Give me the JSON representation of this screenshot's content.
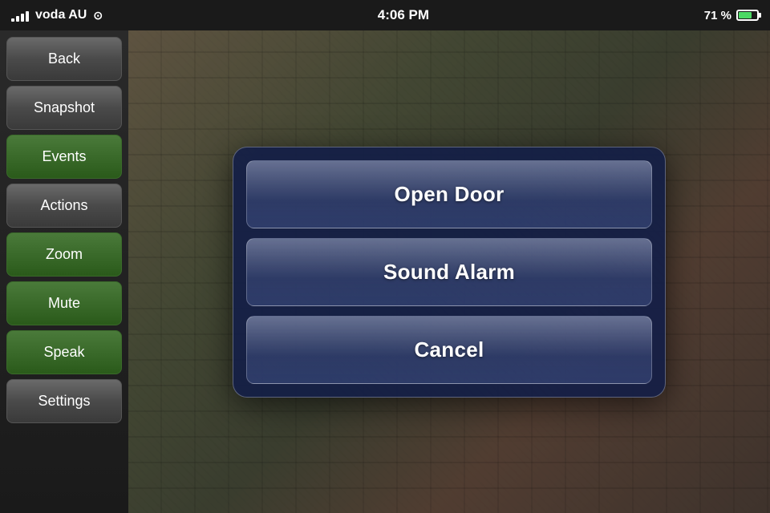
{
  "statusBar": {
    "carrier": "voda AU",
    "time": "4:06 PM",
    "battery": "71 %"
  },
  "sidebar": {
    "buttons": [
      {
        "label": "Back",
        "style": "gray"
      },
      {
        "label": "Snapshot",
        "style": "gray"
      },
      {
        "label": "Events",
        "style": "green"
      },
      {
        "label": "Actions",
        "style": "gray"
      },
      {
        "label": "Zoom",
        "style": "green"
      },
      {
        "label": "Mute",
        "style": "green"
      },
      {
        "label": "Speak",
        "style": "green"
      },
      {
        "label": "Settings",
        "style": "gray"
      }
    ]
  },
  "actionSheet": {
    "buttons": [
      {
        "label": "Open Door"
      },
      {
        "label": "Sound Alarm"
      },
      {
        "label": "Cancel"
      }
    ]
  }
}
